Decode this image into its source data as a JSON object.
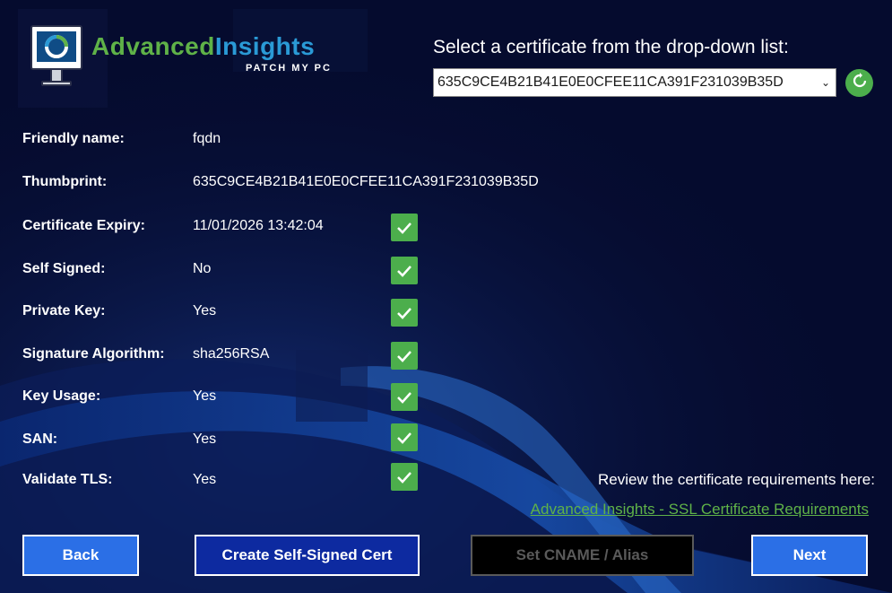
{
  "logo": {
    "word1": "Advanced",
    "word2": "Insights",
    "subtitle": "PATCH MY PC"
  },
  "header": {
    "select_label": "Select a certificate from the drop-down list:",
    "selected_certificate": "635C9CE4B21B41E0E0CFEE11CA391F231039B35D",
    "refresh_icon": "refresh-icon"
  },
  "properties": [
    {
      "label": "Friendly name:",
      "value": "fqdn",
      "check": false
    },
    {
      "label": "Thumbprint:",
      "value": "635C9CE4B21B41E0E0CFEE11CA391F231039B35D",
      "check": false
    },
    {
      "label": "Certificate Expiry:",
      "value": "11/01/2026 13:42:04",
      "check": true
    },
    {
      "label": "Self Signed:",
      "value": "No",
      "check": true
    },
    {
      "label": "Private Key:",
      "value": "Yes",
      "check": true
    },
    {
      "label": "Signature Algorithm:",
      "value": "sha256RSA",
      "check": true
    },
    {
      "label": "Key Usage:",
      "value": "Yes",
      "check": true
    },
    {
      "label": "SAN:",
      "value": "Yes",
      "check": true
    },
    {
      "label": "Validate TLS:",
      "value": "Yes",
      "check": true
    }
  ],
  "requirements": {
    "text": "Review the certificate requirements here:",
    "link": "Advanced Insights - SSL Certificate Requirements"
  },
  "buttons": {
    "back": "Back",
    "create": "Create Self-Signed Cert",
    "cname": "Set CNAME / Alias",
    "next": "Next"
  },
  "colors": {
    "background": "#050b2e",
    "accent_green": "#4cae4c",
    "button_blue": "#2b6fe6",
    "button_dark_blue": "#0d2aa0",
    "link_green": "#5fb248"
  }
}
